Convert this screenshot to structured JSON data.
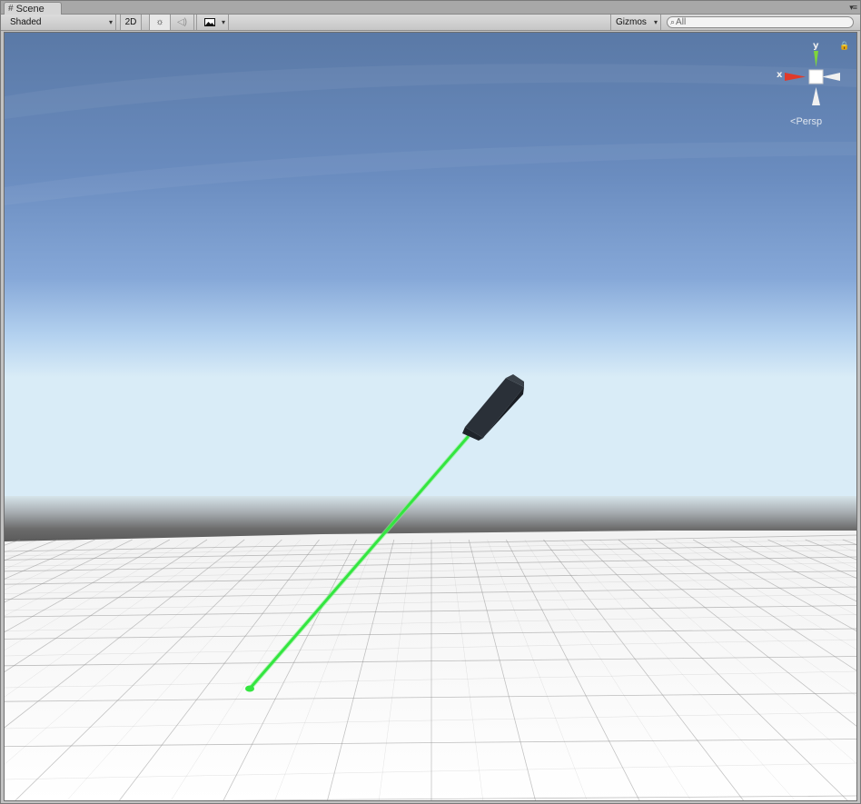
{
  "tab": {
    "title": "Scene",
    "icon": "scene-grid-icon"
  },
  "toolbar": {
    "draw_mode": "Shaded",
    "mode_2d": "2D",
    "lighting_icon": "sun-icon",
    "audio_icon": "speaker-icon",
    "effects_icon": "image-icon",
    "gizmos": "Gizmos",
    "search_placeholder": "All"
  },
  "scene_gizmo": {
    "x_label": "x",
    "y_label": "y",
    "projection": "Persp",
    "lock_icon": "lock-icon"
  },
  "colors": {
    "sky_top": "#5a79a6",
    "horizon": "#d9ecf7",
    "ground_band": "#5d5d5d",
    "ground": "#f4f4f4",
    "laser": "#33e640",
    "pointer_body": "#262b33",
    "x_axis": "#e03a2a",
    "y_axis": "#7fd63a"
  }
}
